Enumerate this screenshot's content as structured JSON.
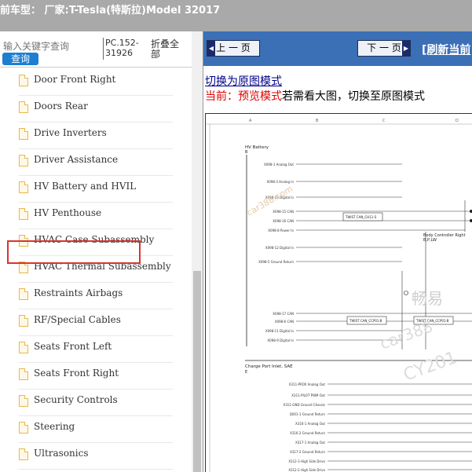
{
  "topbar": {
    "title": "前车型： 厂家:T-Tesla(特斯拉)Model 32017"
  },
  "sidebar": {
    "search_placeholder": "输入关键字查询",
    "search_button": "查询",
    "pc_code": "PC.152-31926",
    "collapse_label": "折叠全部",
    "items": [
      {
        "label": "Door Front Right"
      },
      {
        "label": "Doors Rear"
      },
      {
        "label": "Drive Inverters"
      },
      {
        "label": "Driver Assistance"
      },
      {
        "label": "HV Battery and HVIL",
        "selected": true
      },
      {
        "label": "HV Penthouse"
      },
      {
        "label": "HVAC Case Subassembly"
      },
      {
        "label": "HVAC Thermal Subassembly"
      },
      {
        "label": "Restraints Airbags"
      },
      {
        "label": "RF/Special Cables"
      },
      {
        "label": "Seats Front Left"
      },
      {
        "label": "Seats Front Right"
      },
      {
        "label": "Security Controls"
      },
      {
        "label": "Steering"
      },
      {
        "label": "Ultrasonics"
      }
    ]
  },
  "viewer": {
    "prev_label": "上 一 页",
    "next_label": "下 一 页",
    "refresh_label": "[刷新当前",
    "switch_link": "切换为原图模式",
    "mode_current": "当前：",
    "mode_name": "预览模式",
    "mode_hint": "若需看大图，切换至原图模式"
  },
  "diagram": {
    "section1_title": "HV Battery",
    "section1_sub": "B",
    "section2_title": "Charge Port Inlet, SAE",
    "section2_sub": "E",
    "body_controller": "Body Controller Right",
    "body_controller_code": "B,P,LW",
    "twist_label_1": "TWIST CAN_CH11-S",
    "twist_label_2": "TWIST CAN_CCP01-B",
    "twist_label_3": "TWIST CAN_CCP01-B",
    "column_labels": [
      "A",
      "B",
      "C",
      "D"
    ],
    "left_pins": [
      "X098-1 Analog Out",
      "X098-3 Analog In",
      "X098-13 Digital In",
      "X098-15 CAN",
      "X098-16 CAN",
      "X098-8 Power In",
      "X098-12 Digital In",
      "X098-5 Ground Return",
      "X098-17 CAN",
      "X098-6 CAN",
      "X098-11 Digital In",
      "X098-9 Digital In"
    ],
    "port_pins": [
      "X311-PROX Analog Out",
      "X311-PILOT PWM Out",
      "X311-GND Ground Chassis",
      "Q001-1 Ground Return",
      "X316-1 Analog Out",
      "X316-2 Ground Return",
      "X317-1 Analog Out",
      "X317-2 Ground Return",
      "X312-3 High Side Drive",
      "X312-2 High Side Drive"
    ],
    "watermark_1": "car388.com",
    "watermark_2": "畅易",
    "watermark_3": "car388",
    "watermark_4": "CY201"
  },
  "colors": {
    "topbar": "#a9a9a9",
    "search_button": "#1e7fd2",
    "viewer_header": "#3b6fb6",
    "highlight": "#d9342b",
    "mode_red": "#e00000",
    "link": "#00008b"
  },
  "icons": {
    "tree_item": "document-icon",
    "prev": "arrow-left-icon",
    "next": "arrow-right-icon"
  }
}
